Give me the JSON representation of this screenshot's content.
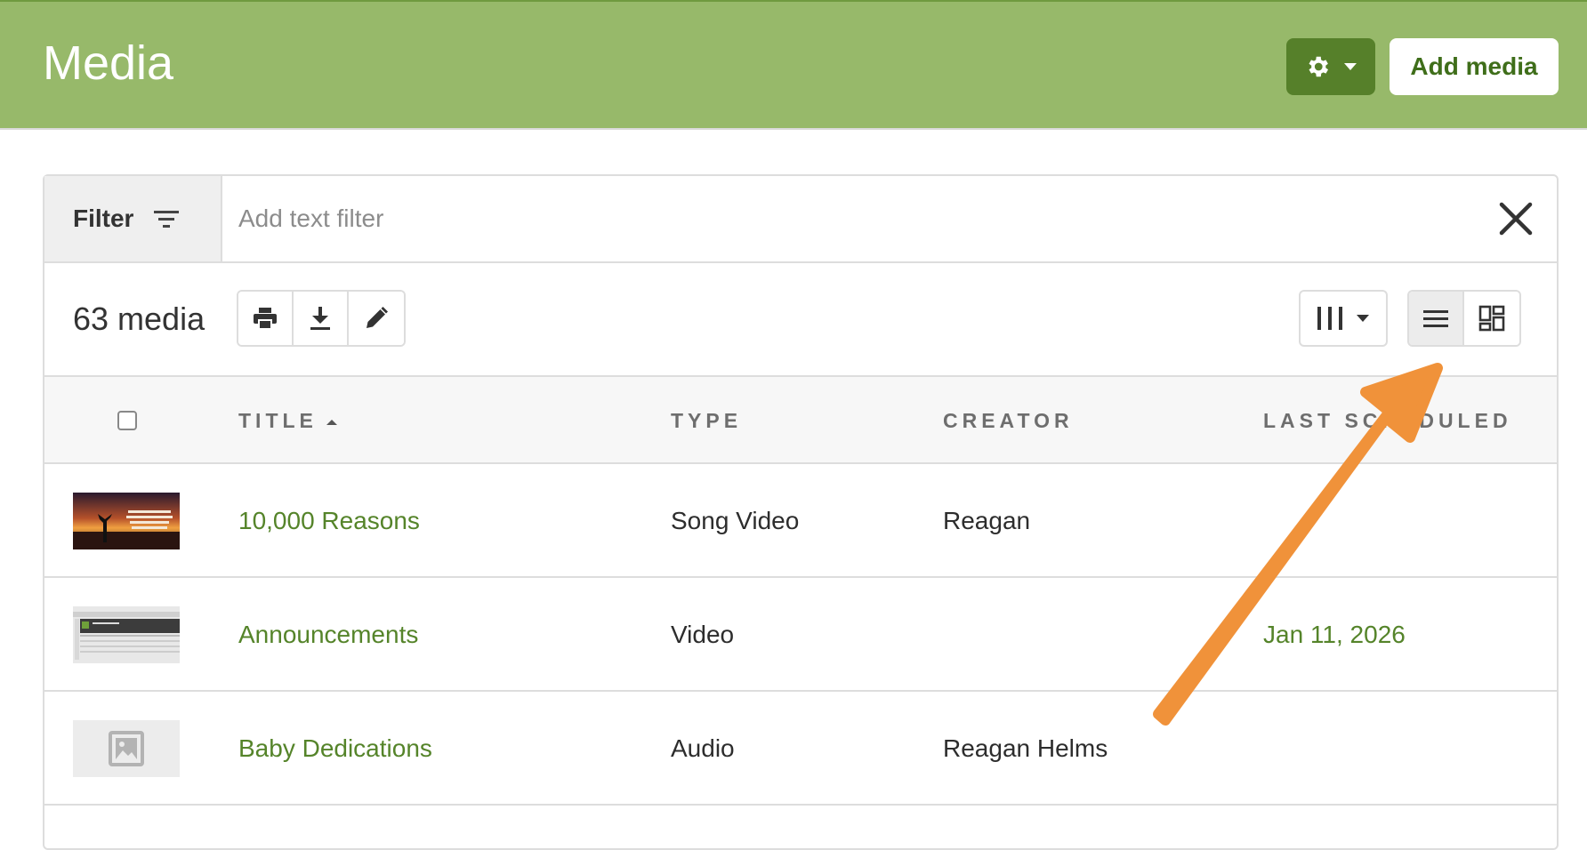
{
  "header": {
    "title": "Media",
    "add_label": "Add media"
  },
  "filter": {
    "label": "Filter",
    "placeholder": "Add text filter"
  },
  "toolbar": {
    "count": "63 media"
  },
  "table": {
    "columns": {
      "title": "TITLE",
      "type": "TYPE",
      "creator": "CREATOR",
      "last_scheduled": "LAST SCHEDULED"
    },
    "rows": [
      {
        "title": "10,000 Reasons",
        "type": "Song Video",
        "creator": "Reagan",
        "last_scheduled": ""
      },
      {
        "title": "Announcements",
        "type": "Video",
        "creator": "",
        "last_scheduled": "Jan 11, 2026"
      },
      {
        "title": "Baby Dedications",
        "type": "Audio",
        "creator": "Reagan Helms",
        "last_scheduled": ""
      }
    ]
  },
  "colors": {
    "header_bg": "#97b96a",
    "accent_dark": "#56802a",
    "link": "#55842a",
    "annotation_arrow": "#f0923a"
  },
  "icons": [
    "gear-icon",
    "caret-down-icon",
    "filter-icon",
    "close-icon",
    "print-icon",
    "download-icon",
    "edit-icon",
    "columns-icon",
    "list-view-icon",
    "grid-view-icon",
    "sort-asc-icon",
    "image-placeholder-icon"
  ]
}
